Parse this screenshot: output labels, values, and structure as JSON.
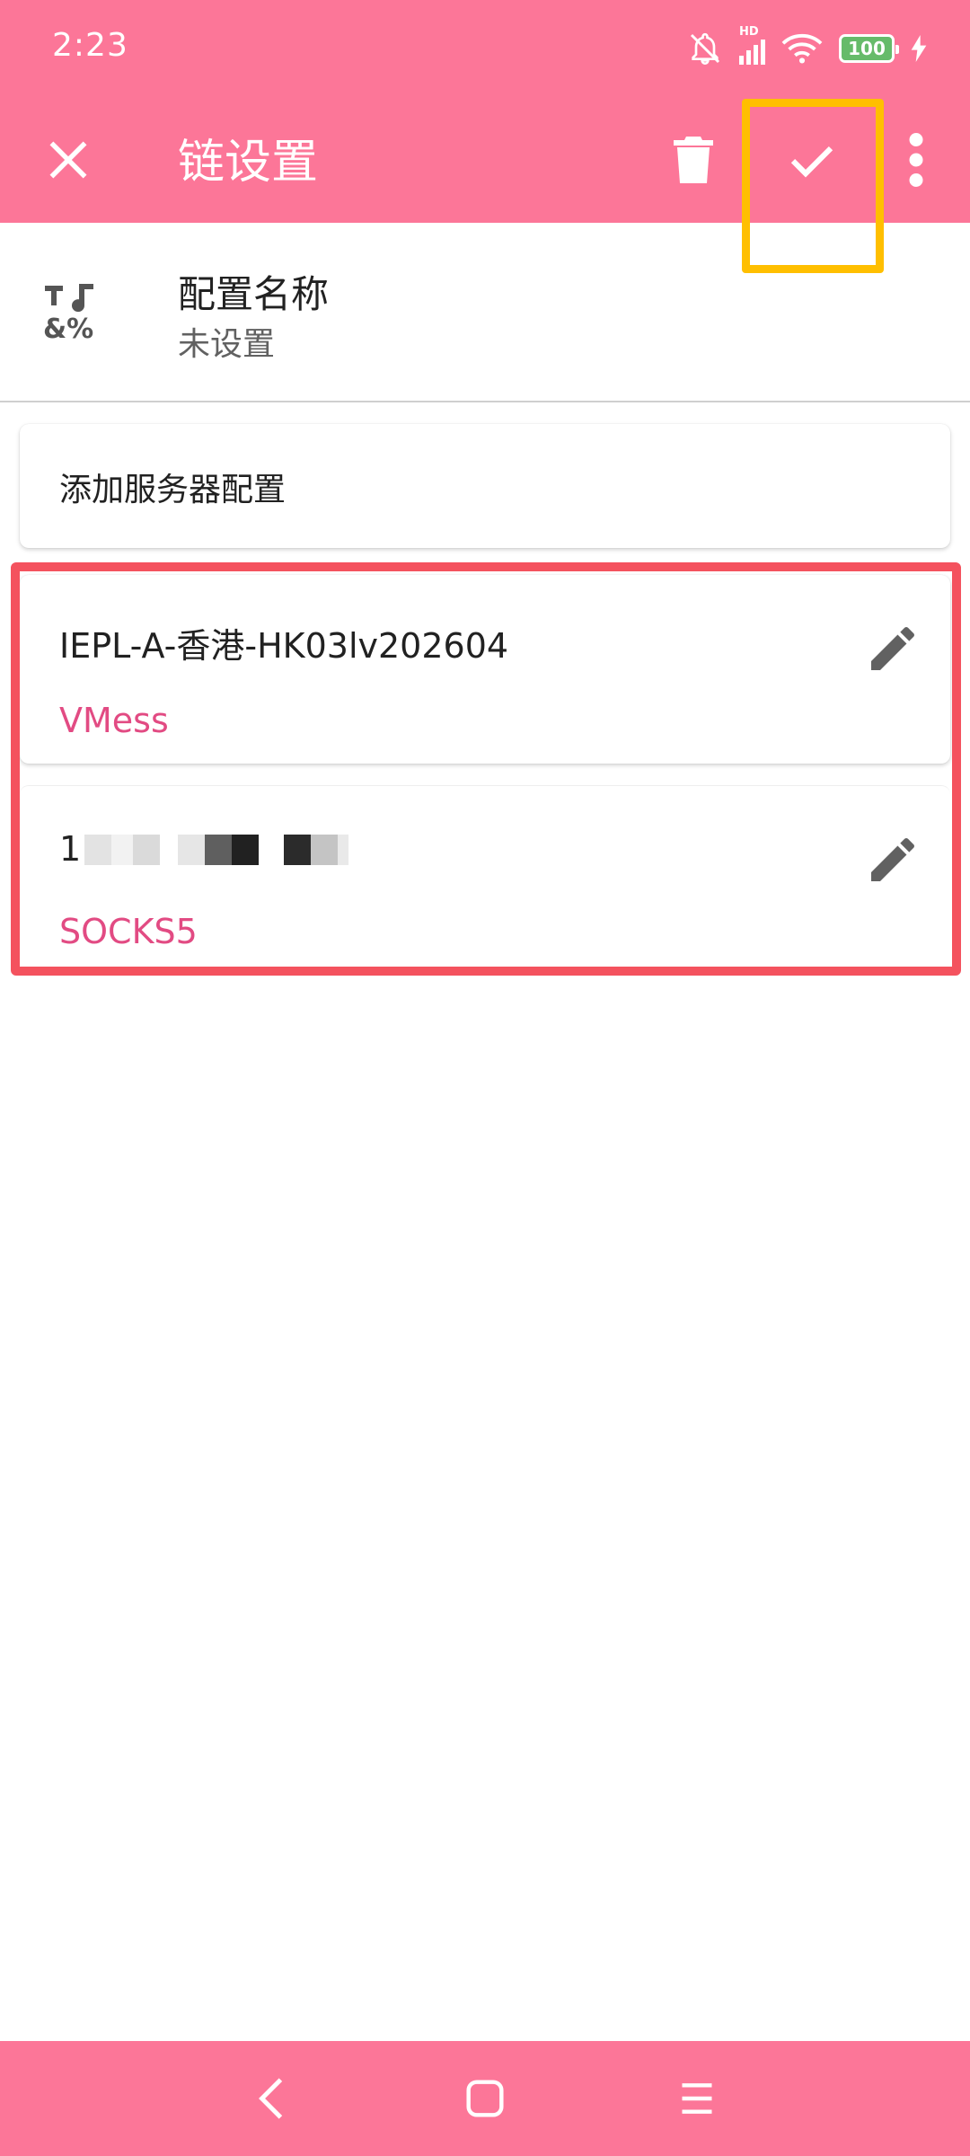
{
  "status": {
    "time": "2:23",
    "battery": "100",
    "signal_label": "HD"
  },
  "toolbar": {
    "title": "链设置",
    "close_icon": "close-icon",
    "delete_icon": "trash-icon",
    "save_icon": "check-icon",
    "more_icon": "more-vert-icon"
  },
  "profile": {
    "title": "配置名称",
    "value": "未设置"
  },
  "add_server": {
    "label": "添加服务器配置"
  },
  "servers": [
    {
      "name": "IEPL-A-香港-HK03lv202604",
      "protocol": "VMess"
    },
    {
      "name": "1",
      "protocol": "SOCKS5"
    }
  ],
  "colors": {
    "primary": "#fc7698",
    "accent_text": "#e24b83",
    "highlight_yellow": "#ffbf00",
    "highlight_red": "#f4525e"
  }
}
